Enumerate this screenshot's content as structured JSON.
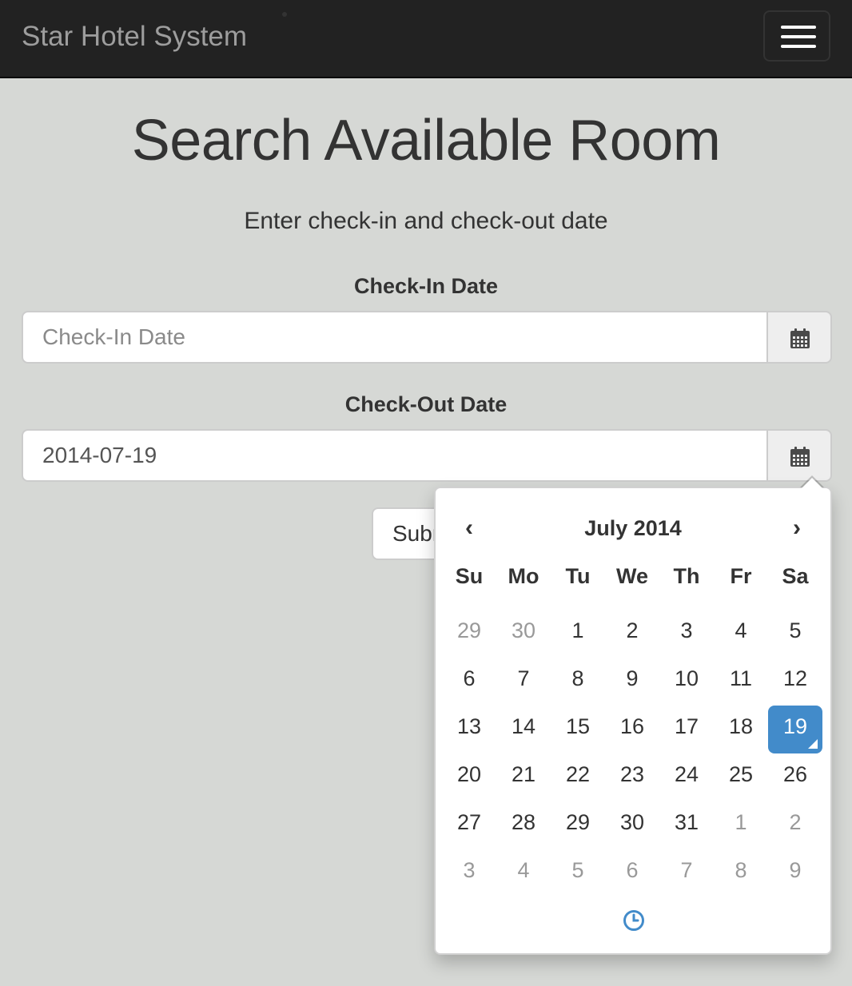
{
  "navbar": {
    "brand": "Star Hotel System",
    "menu_icon": "hamburger-menu-icon"
  },
  "page": {
    "title": "Search Available Room",
    "subtitle": "Enter check-in and check-out date"
  },
  "form": {
    "checkin": {
      "label": "Check-In Date",
      "placeholder": "Check-In Date",
      "value": "",
      "icon": "calendar-icon"
    },
    "checkout": {
      "label": "Check-Out Date",
      "placeholder": "Check-Out Date",
      "value": "2014-07-19",
      "icon": "calendar-icon"
    },
    "submit_label": "Submit"
  },
  "datepicker": {
    "prev": "‹",
    "next": "›",
    "month_title": "July 2014",
    "weekdays": [
      "Su",
      "Mo",
      "Tu",
      "We",
      "Th",
      "Fr",
      "Sa"
    ],
    "weeks": [
      [
        {
          "d": "29",
          "m": true
        },
        {
          "d": "30",
          "m": true
        },
        {
          "d": "1"
        },
        {
          "d": "2"
        },
        {
          "d": "3"
        },
        {
          "d": "4"
        },
        {
          "d": "5"
        }
      ],
      [
        {
          "d": "6"
        },
        {
          "d": "7"
        },
        {
          "d": "8"
        },
        {
          "d": "9"
        },
        {
          "d": "10"
        },
        {
          "d": "11"
        },
        {
          "d": "12"
        }
      ],
      [
        {
          "d": "13"
        },
        {
          "d": "14"
        },
        {
          "d": "15"
        },
        {
          "d": "16"
        },
        {
          "d": "17"
        },
        {
          "d": "18"
        },
        {
          "d": "19",
          "a": true
        }
      ],
      [
        {
          "d": "20"
        },
        {
          "d": "21"
        },
        {
          "d": "22"
        },
        {
          "d": "23"
        },
        {
          "d": "24"
        },
        {
          "d": "25"
        },
        {
          "d": "26"
        }
      ],
      [
        {
          "d": "27"
        },
        {
          "d": "28"
        },
        {
          "d": "29"
        },
        {
          "d": "30"
        },
        {
          "d": "31"
        },
        {
          "d": "1",
          "m": true
        },
        {
          "d": "2",
          "m": true
        }
      ],
      [
        {
          "d": "3",
          "m": true
        },
        {
          "d": "4",
          "m": true
        },
        {
          "d": "5",
          "m": true
        },
        {
          "d": "6",
          "m": true
        },
        {
          "d": "7",
          "m": true
        },
        {
          "d": "8",
          "m": true
        },
        {
          "d": "9",
          "m": true
        }
      ]
    ],
    "selected_color": "#428bca",
    "time_toggle_icon": "clock-icon"
  }
}
